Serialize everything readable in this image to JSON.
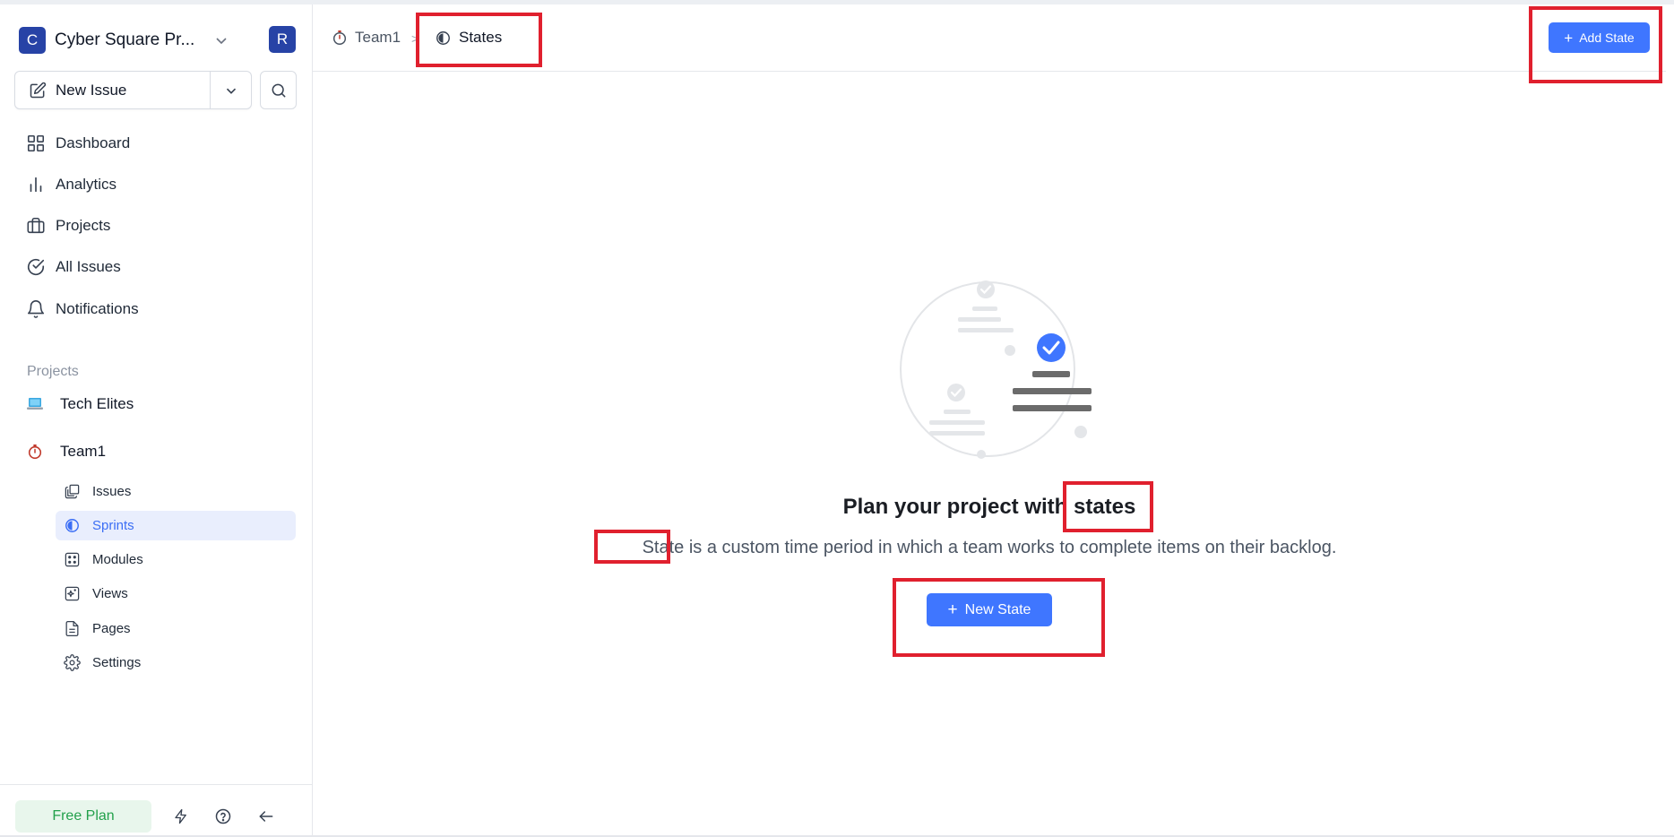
{
  "workspace": {
    "initial": "C",
    "name": "Cyber Square Pr...",
    "user_initial": "R"
  },
  "sidebar": {
    "new_issue_label": "New Issue",
    "nav": [
      {
        "label": "Dashboard",
        "icon": "dashboard-icon"
      },
      {
        "label": "Analytics",
        "icon": "analytics-icon"
      },
      {
        "label": "Projects",
        "icon": "briefcase-icon"
      },
      {
        "label": "All Issues",
        "icon": "check-circle-icon"
      },
      {
        "label": "Notifications",
        "icon": "bell-icon"
      }
    ],
    "projects_heading": "Projects",
    "projects": [
      {
        "label": "Tech Elites",
        "icon": "laptop-emoji-icon"
      },
      {
        "label": "Team1",
        "icon": "stopwatch-emoji-icon"
      }
    ],
    "project_sub_items": [
      {
        "label": "Issues",
        "icon": "layers-icon",
        "active": false
      },
      {
        "label": "Sprints",
        "icon": "contrast-circle-icon",
        "active": true
      },
      {
        "label": "Modules",
        "icon": "grid-dice-icon",
        "active": false
      },
      {
        "label": "Views",
        "icon": "sparkle-view-icon",
        "active": false
      },
      {
        "label": "Pages",
        "icon": "document-icon",
        "active": false
      },
      {
        "label": "Settings",
        "icon": "gear-icon",
        "active": false
      }
    ],
    "footer": {
      "plan_label": "Free Plan"
    }
  },
  "header": {
    "breadcrumb": [
      {
        "label": "Team1",
        "icon": "stopwatch-emoji-icon"
      },
      {
        "label": "States",
        "icon": "contrast-circle-icon"
      }
    ],
    "separator": ">",
    "add_button_label": "Add State"
  },
  "empty_state": {
    "title": "Plan your project with states",
    "description": "State is a custom time period in which a team works to complete items on their backlog.",
    "button_label": "New State"
  },
  "colors": {
    "primary": "#3f76ff",
    "workspace_logo": "#2743a6",
    "active_nav_bg": "#e9eefd",
    "free_plan_bg": "#e8f6ec",
    "free_plan_text": "#22a04b",
    "annotation_red": "#e0202e"
  }
}
